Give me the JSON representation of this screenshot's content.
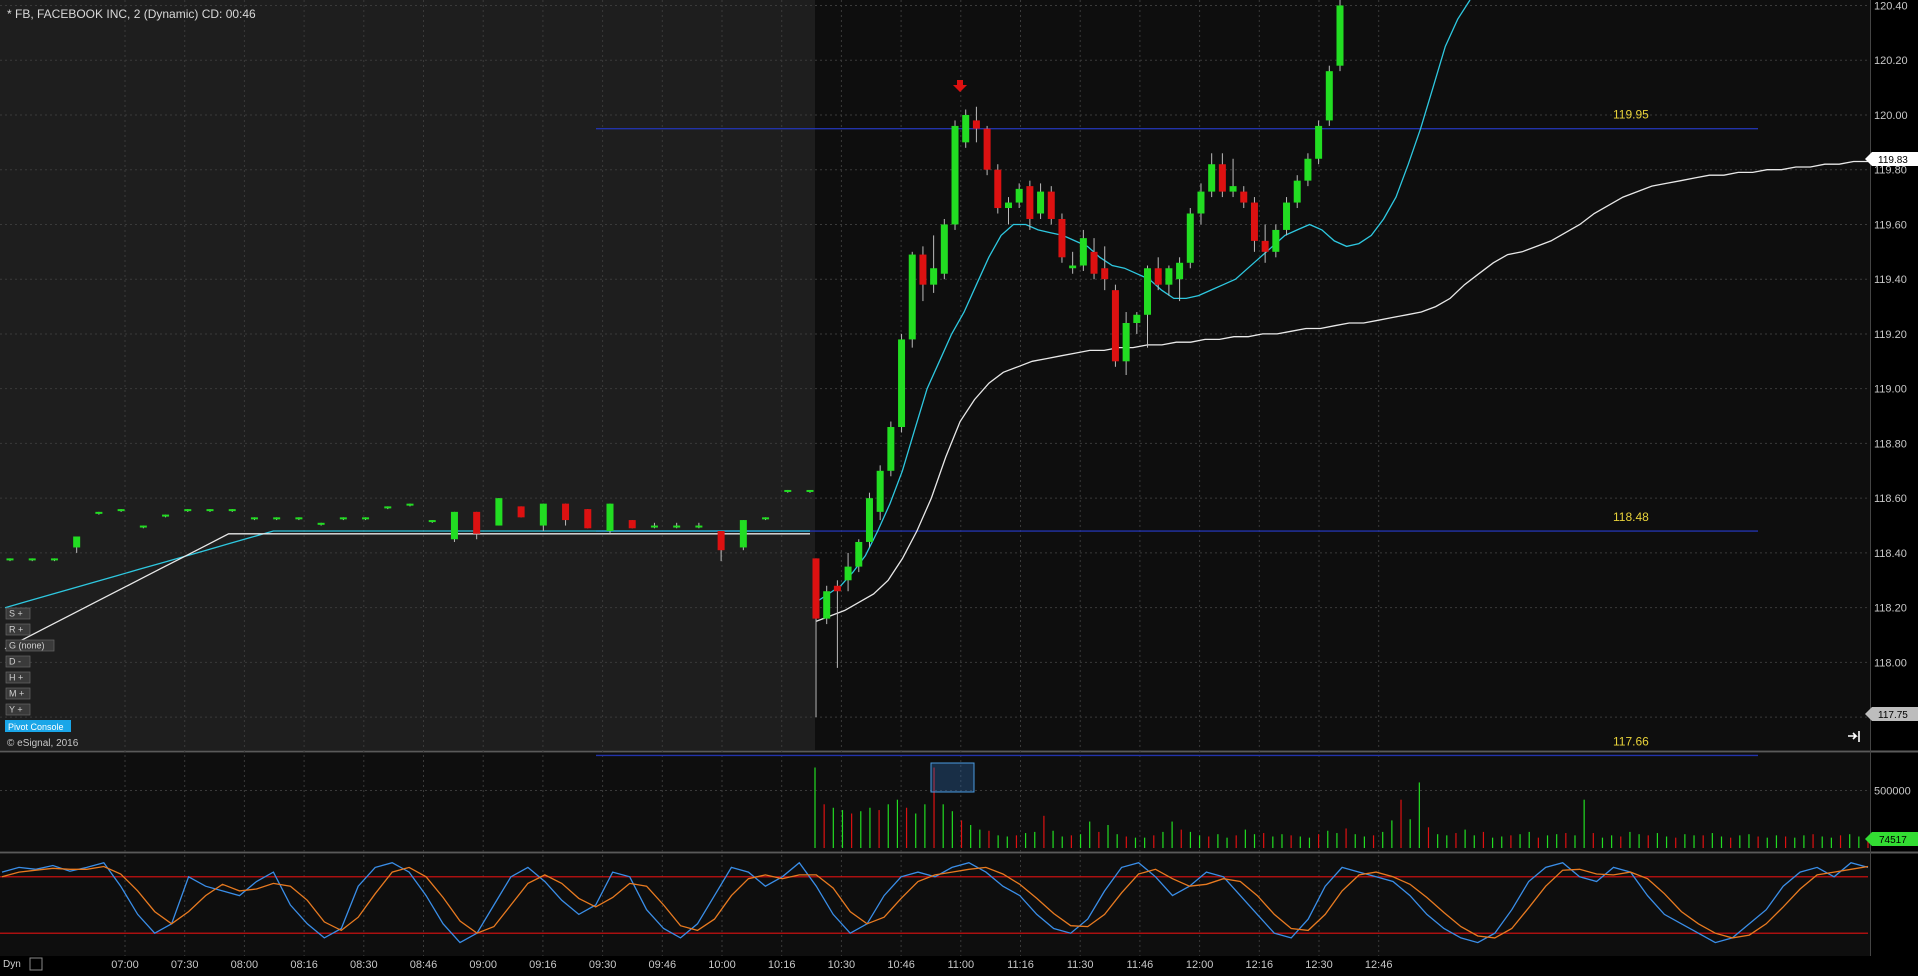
{
  "window": {
    "title": "* FB, FACEBOOK INC, 2 (Dynamic) CD: 00:46",
    "copyright": "© eSignal, 2016",
    "pivot_console": "Pivot Console",
    "dyn_label": "Dyn"
  },
  "side_buttons": [
    {
      "label": "S +",
      "icon": "plus-icon"
    },
    {
      "label": "R +",
      "icon": "plus-icon"
    },
    {
      "label": "G (none)",
      "icon": ""
    },
    {
      "label": "D -",
      "icon": "minus-icon"
    },
    {
      "label": "H +",
      "icon": "plus-icon"
    },
    {
      "label": "M +",
      "icon": "plus-icon"
    },
    {
      "label": "Y +",
      "icon": "plus-icon"
    }
  ],
  "colors": {
    "up": "#22dd22",
    "down": "#dd1111",
    "fast_ma": "#2ec8e0",
    "slow_ma": "#e8e8e8",
    "pivot_line": "#2233aa",
    "pivot_label": "#e8d23a",
    "stoch_k": "#3a8ee8",
    "stoch_d": "#e87a20",
    "stoch_bounds": "#dd1111",
    "current_price_box": "#ffffff",
    "volume_badge": "#33dd33"
  },
  "chart_data": [
    {
      "type": "candlestick",
      "title": "* FB, FACEBOOK INC, 2 (Dynamic) CD: 00:46",
      "ylim": [
        117.68,
        120.42
      ],
      "y_ticks": [
        "117.80",
        "118.00",
        "118.20",
        "118.40",
        "118.60",
        "118.80",
        "119.00",
        "119.20",
        "119.40",
        "119.60",
        "119.80",
        "120.00",
        "120.20",
        "120.40"
      ],
      "x_ticks": [
        "07:00",
        "07:30",
        "08:00",
        "08:16",
        "08:30",
        "08:46",
        "09:00",
        "09:16",
        "09:30",
        "09:46",
        "10:00",
        "10:16",
        "10:30",
        "10:46",
        "11:00",
        "11:16",
        "11:30",
        "11:46",
        "12:00",
        "12:16",
        "12:30",
        "12:46"
      ],
      "current_price": "119.83",
      "secondary_price": "117.75",
      "pivot_levels": [
        {
          "value": 119.95,
          "label": "119.95"
        },
        {
          "value": 118.48,
          "label": "118.48"
        },
        {
          "value": 117.66,
          "label": "117.66"
        }
      ],
      "candles_premarket": [
        {
          "o": 118.38,
          "h": 118.38,
          "l": 118.37,
          "c": 118.38
        },
        {
          "o": 118.38,
          "h": 118.38,
          "l": 118.37,
          "c": 118.38
        },
        {
          "o": 118.38,
          "h": 118.38,
          "l": 118.37,
          "c": 118.38
        },
        {
          "o": 118.42,
          "h": 118.46,
          "l": 118.4,
          "c": 118.46
        },
        {
          "o": 118.55,
          "h": 118.55,
          "l": 118.54,
          "c": 118.55
        },
        {
          "o": 118.56,
          "h": 118.56,
          "l": 118.55,
          "c": 118.56
        },
        {
          "o": 118.5,
          "h": 118.5,
          "l": 118.49,
          "c": 118.5
        },
        {
          "o": 118.54,
          "h": 118.54,
          "l": 118.53,
          "c": 118.54
        },
        {
          "o": 118.56,
          "h": 118.56,
          "l": 118.55,
          "c": 118.56
        },
        {
          "o": 118.56,
          "h": 118.56,
          "l": 118.55,
          "c": 118.56
        },
        {
          "o": 118.56,
          "h": 118.56,
          "l": 118.55,
          "c": 118.56
        },
        {
          "o": 118.53,
          "h": 118.53,
          "l": 118.52,
          "c": 118.53
        },
        {
          "o": 118.53,
          "h": 118.53,
          "l": 118.52,
          "c": 118.53
        },
        {
          "o": 118.53,
          "h": 118.53,
          "l": 118.52,
          "c": 118.53
        },
        {
          "o": 118.51,
          "h": 118.51,
          "l": 118.5,
          "c": 118.51
        },
        {
          "o": 118.53,
          "h": 118.53,
          "l": 118.52,
          "c": 118.53
        },
        {
          "o": 118.53,
          "h": 118.53,
          "l": 118.52,
          "c": 118.53
        },
        {
          "o": 118.57,
          "h": 118.57,
          "l": 118.56,
          "c": 118.57
        },
        {
          "o": 118.58,
          "h": 118.58,
          "l": 118.57,
          "c": 118.58
        },
        {
          "o": 118.52,
          "h": 118.52,
          "l": 118.51,
          "c": 118.52
        },
        {
          "o": 118.45,
          "h": 118.55,
          "l": 118.44,
          "c": 118.55
        },
        {
          "o": 118.55,
          "h": 118.55,
          "l": 118.45,
          "c": 118.47
        },
        {
          "o": 118.5,
          "h": 118.6,
          "l": 118.5,
          "c": 118.6
        },
        {
          "o": 118.57,
          "h": 118.57,
          "l": 118.53,
          "c": 118.53
        },
        {
          "o": 118.5,
          "h": 118.58,
          "l": 118.48,
          "c": 118.58
        },
        {
          "o": 118.58,
          "h": 118.58,
          "l": 118.5,
          "c": 118.52
        },
        {
          "o": 118.56,
          "h": 118.56,
          "l": 118.49,
          "c": 118.49
        },
        {
          "o": 118.48,
          "h": 118.58,
          "l": 118.47,
          "c": 118.58
        },
        {
          "o": 118.52,
          "h": 118.52,
          "l": 118.49,
          "c": 118.49
        },
        {
          "o": 118.5,
          "h": 118.51,
          "l": 118.49,
          "c": 118.5
        },
        {
          "o": 118.5,
          "h": 118.51,
          "l": 118.49,
          "c": 118.5
        },
        {
          "o": 118.5,
          "h": 118.51,
          "l": 118.49,
          "c": 118.5
        },
        {
          "o": 118.48,
          "h": 118.48,
          "l": 118.37,
          "c": 118.41
        },
        {
          "o": 118.42,
          "h": 118.52,
          "l": 118.41,
          "c": 118.52
        },
        {
          "o": 118.53,
          "h": 118.53,
          "l": 118.52,
          "c": 118.53
        },
        {
          "o": 118.63,
          "h": 118.63,
          "l": 118.62,
          "c": 118.63
        },
        {
          "o": 118.63,
          "h": 118.63,
          "l": 118.62,
          "c": 118.63
        }
      ],
      "candles_session": [
        {
          "o": 118.38,
          "h": 118.38,
          "l": 117.8,
          "c": 118.16
        },
        {
          "o": 118.16,
          "h": 118.28,
          "l": 118.14,
          "c": 118.26
        },
        {
          "o": 118.28,
          "h": 118.3,
          "l": 117.98,
          "c": 118.26
        },
        {
          "o": 118.3,
          "h": 118.4,
          "l": 118.26,
          "c": 118.35
        },
        {
          "o": 118.35,
          "h": 118.45,
          "l": 118.33,
          "c": 118.44
        },
        {
          "o": 118.44,
          "h": 118.62,
          "l": 118.42,
          "c": 118.6
        },
        {
          "o": 118.55,
          "h": 118.72,
          "l": 118.52,
          "c": 118.7
        },
        {
          "o": 118.7,
          "h": 118.88,
          "l": 118.68,
          "c": 118.86
        },
        {
          "o": 118.86,
          "h": 119.2,
          "l": 118.84,
          "c": 119.18
        },
        {
          "o": 119.18,
          "h": 119.5,
          "l": 119.15,
          "c": 119.49
        },
        {
          "o": 119.49,
          "h": 119.52,
          "l": 119.32,
          "c": 119.38
        },
        {
          "o": 119.38,
          "h": 119.56,
          "l": 119.35,
          "c": 119.44
        },
        {
          "o": 119.42,
          "h": 119.62,
          "l": 119.4,
          "c": 119.6
        },
        {
          "o": 119.6,
          "h": 119.98,
          "l": 119.58,
          "c": 119.96
        },
        {
          "o": 119.9,
          "h": 120.02,
          "l": 119.88,
          "c": 120.0
        },
        {
          "o": 119.98,
          "h": 120.03,
          "l": 119.9,
          "c": 119.95
        },
        {
          "o": 119.95,
          "h": 119.96,
          "l": 119.78,
          "c": 119.8
        },
        {
          "o": 119.8,
          "h": 119.82,
          "l": 119.64,
          "c": 119.66
        },
        {
          "o": 119.66,
          "h": 119.7,
          "l": 119.6,
          "c": 119.68
        },
        {
          "o": 119.68,
          "h": 119.75,
          "l": 119.66,
          "c": 119.73
        },
        {
          "o": 119.74,
          "h": 119.76,
          "l": 119.58,
          "c": 119.62
        },
        {
          "o": 119.64,
          "h": 119.75,
          "l": 119.62,
          "c": 119.72
        },
        {
          "o": 119.72,
          "h": 119.74,
          "l": 119.6,
          "c": 119.62
        },
        {
          "o": 119.62,
          "h": 119.64,
          "l": 119.46,
          "c": 119.48
        },
        {
          "o": 119.44,
          "h": 119.5,
          "l": 119.42,
          "c": 119.45
        },
        {
          "o": 119.45,
          "h": 119.58,
          "l": 119.43,
          "c": 119.55
        },
        {
          "o": 119.5,
          "h": 119.55,
          "l": 119.4,
          "c": 119.42
        },
        {
          "o": 119.44,
          "h": 119.52,
          "l": 119.36,
          "c": 119.4
        },
        {
          "o": 119.36,
          "h": 119.38,
          "l": 119.08,
          "c": 119.1
        },
        {
          "o": 119.1,
          "h": 119.28,
          "l": 119.05,
          "c": 119.24
        },
        {
          "o": 119.24,
          "h": 119.28,
          "l": 119.2,
          "c": 119.27
        },
        {
          "o": 119.27,
          "h": 119.45,
          "l": 119.15,
          "c": 119.44
        },
        {
          "o": 119.44,
          "h": 119.48,
          "l": 119.36,
          "c": 119.38
        },
        {
          "o": 119.38,
          "h": 119.45,
          "l": 119.34,
          "c": 119.44
        },
        {
          "o": 119.4,
          "h": 119.48,
          "l": 119.32,
          "c": 119.46
        },
        {
          "o": 119.46,
          "h": 119.66,
          "l": 119.44,
          "c": 119.64
        },
        {
          "o": 119.64,
          "h": 119.75,
          "l": 119.6,
          "c": 119.72
        },
        {
          "o": 119.72,
          "h": 119.86,
          "l": 119.7,
          "c": 119.82
        },
        {
          "o": 119.82,
          "h": 119.86,
          "l": 119.7,
          "c": 119.72
        },
        {
          "o": 119.72,
          "h": 119.84,
          "l": 119.7,
          "c": 119.74
        },
        {
          "o": 119.72,
          "h": 119.74,
          "l": 119.66,
          "c": 119.68
        },
        {
          "o": 119.68,
          "h": 119.7,
          "l": 119.5,
          "c": 119.54
        },
        {
          "o": 119.54,
          "h": 119.6,
          "l": 119.46,
          "c": 119.5
        },
        {
          "o": 119.5,
          "h": 119.6,
          "l": 119.48,
          "c": 119.58
        },
        {
          "o": 119.58,
          "h": 119.7,
          "l": 119.56,
          "c": 119.68
        },
        {
          "o": 119.68,
          "h": 119.78,
          "l": 119.66,
          "c": 119.76
        },
        {
          "o": 119.76,
          "h": 119.86,
          "l": 119.74,
          "c": 119.84
        },
        {
          "o": 119.84,
          "h": 119.98,
          "l": 119.82,
          "c": 119.96
        },
        {
          "o": 119.98,
          "h": 120.18,
          "l": 119.96,
          "c": 120.16
        },
        {
          "o": 120.18,
          "h": 120.42,
          "l": 120.16,
          "c": 120.4
        }
      ],
      "fast_ma": [
        118.22,
        118.25,
        118.28,
        118.33,
        118.39,
        118.48,
        118.58,
        118.7,
        118.85,
        119.0,
        119.1,
        119.2,
        119.28,
        119.38,
        119.48,
        119.56,
        119.6,
        119.6,
        119.58,
        119.57,
        119.56,
        119.54,
        119.52,
        119.48,
        119.45,
        119.44,
        119.42,
        119.4,
        119.36,
        119.33,
        119.33,
        119.34,
        119.36,
        119.38,
        119.4,
        119.44,
        119.48,
        119.52,
        119.56,
        119.58,
        119.6,
        119.58,
        119.54,
        119.52,
        119.53,
        119.56,
        119.62,
        119.7,
        119.82,
        119.95,
        120.1,
        120.25,
        120.35,
        120.42
      ],
      "slow_ma": [
        118.15,
        118.17,
        118.19,
        118.22,
        118.25,
        118.3,
        118.38,
        118.48,
        118.6,
        118.75,
        118.88,
        118.96,
        119.02,
        119.06,
        119.08,
        119.1,
        119.11,
        119.12,
        119.13,
        119.14,
        119.14,
        119.15,
        119.15,
        119.16,
        119.16,
        119.17,
        119.17,
        119.18,
        119.18,
        119.19,
        119.19,
        119.2,
        119.2,
        119.21,
        119.22,
        119.22,
        119.23,
        119.24,
        119.24,
        119.25,
        119.26,
        119.27,
        119.28,
        119.3,
        119.33,
        119.38,
        119.42,
        119.46,
        119.49,
        119.5,
        119.52,
        119.54,
        119.57,
        119.6,
        119.64,
        119.67,
        119.7,
        119.72,
        119.74,
        119.75,
        119.76,
        119.77,
        119.78,
        119.78,
        119.79,
        119.79,
        119.8,
        119.8,
        119.81,
        119.81,
        119.82,
        119.82,
        119.83,
        119.83
      ]
    },
    {
      "type": "bar",
      "title": "",
      "y_ticks": [
        "500000"
      ],
      "ylim": [
        0,
        800000
      ],
      "current_value": "74517",
      "values": [
        700000,
        380000,
        350000,
        330000,
        300000,
        320000,
        350000,
        330000,
        380000,
        420000,
        350000,
        300000,
        380000,
        700000,
        380000,
        320000,
        240000,
        200000,
        160000,
        150000,
        110000,
        100000,
        110000,
        130000,
        140000,
        280000,
        150000,
        100000,
        110000,
        120000,
        230000,
        140000,
        200000,
        120000,
        100000,
        90000,
        90000,
        110000,
        140000,
        230000,
        160000,
        140000,
        110000,
        100000,
        120000,
        90000,
        110000,
        160000,
        120000,
        130000,
        100000,
        120000,
        110000,
        100000,
        90000,
        120000,
        150000,
        130000,
        170000,
        120000,
        100000,
        110000,
        140000,
        240000,
        420000,
        250000,
        570000,
        180000,
        120000,
        110000,
        130000,
        160000,
        110000,
        140000,
        90000,
        100000,
        110000,
        120000,
        140000,
        90000,
        110000,
        120000,
        130000,
        110000,
        420000,
        130000,
        90000,
        110000,
        100000,
        140000,
        120000,
        110000,
        130000,
        100000,
        90000,
        120000,
        110000,
        110000,
        130000,
        100000,
        90000,
        110000,
        120000,
        100000,
        90000,
        110000,
        100000,
        90000,
        110000,
        120000,
        100000,
        90000,
        110000,
        120000,
        100000,
        90000
      ]
    },
    {
      "type": "line",
      "title": "",
      "ylim": [
        0,
        100
      ],
      "bounds": [
        80,
        20
      ],
      "series": [
        {
          "values": [
            85,
            90,
            88,
            92,
            86,
            90,
            95,
            70,
            40,
            20,
            30,
            80,
            70,
            65,
            60,
            75,
            85,
            50,
            30,
            15,
            25,
            70,
            90,
            95,
            85,
            60,
            30,
            10,
            20,
            50,
            80,
            90,
            75,
            55,
            40,
            50,
            85,
            80,
            45,
            25,
            15,
            30,
            60,
            90,
            85,
            70,
            80,
            95,
            70,
            40,
            20,
            30,
            60,
            80,
            85,
            80,
            90,
            95,
            85,
            70,
            60,
            40,
            25,
            20,
            35,
            65,
            90,
            95,
            80,
            60,
            70,
            85,
            80,
            60,
            40,
            20,
            15,
            35,
            70,
            90,
            85,
            80,
            75,
            60,
            40,
            25,
            15,
            10,
            20,
            45,
            75,
            90,
            95,
            80,
            75,
            90,
            85,
            60,
            40,
            30,
            20,
            10,
            15,
            30,
            45,
            70,
            85,
            90,
            80,
            95,
            90
          ]
        },
        {
          "values": [
            80,
            85,
            87,
            89,
            88,
            88,
            91,
            83,
            65,
            43,
            30,
            43,
            60,
            72,
            65,
            67,
            73,
            70,
            55,
            32,
            23,
            37,
            62,
            85,
            90,
            80,
            58,
            33,
            20,
            27,
            50,
            73,
            82,
            73,
            57,
            48,
            58,
            73,
            70,
            50,
            28,
            23,
            35,
            60,
            78,
            82,
            78,
            82,
            82,
            68,
            43,
            30,
            37,
            57,
            75,
            82,
            85,
            88,
            90,
            83,
            72,
            57,
            41,
            28,
            27,
            40,
            63,
            83,
            88,
            78,
            70,
            72,
            78,
            75,
            60,
            40,
            25,
            23,
            40,
            65,
            82,
            85,
            80,
            72,
            58,
            42,
            27,
            17,
            15,
            25,
            47,
            70,
            87,
            88,
            83,
            82,
            85,
            78,
            62,
            43,
            30,
            20,
            15,
            18,
            30,
            48,
            67,
            82,
            85,
            88,
            91
          ]
        }
      ]
    }
  ]
}
